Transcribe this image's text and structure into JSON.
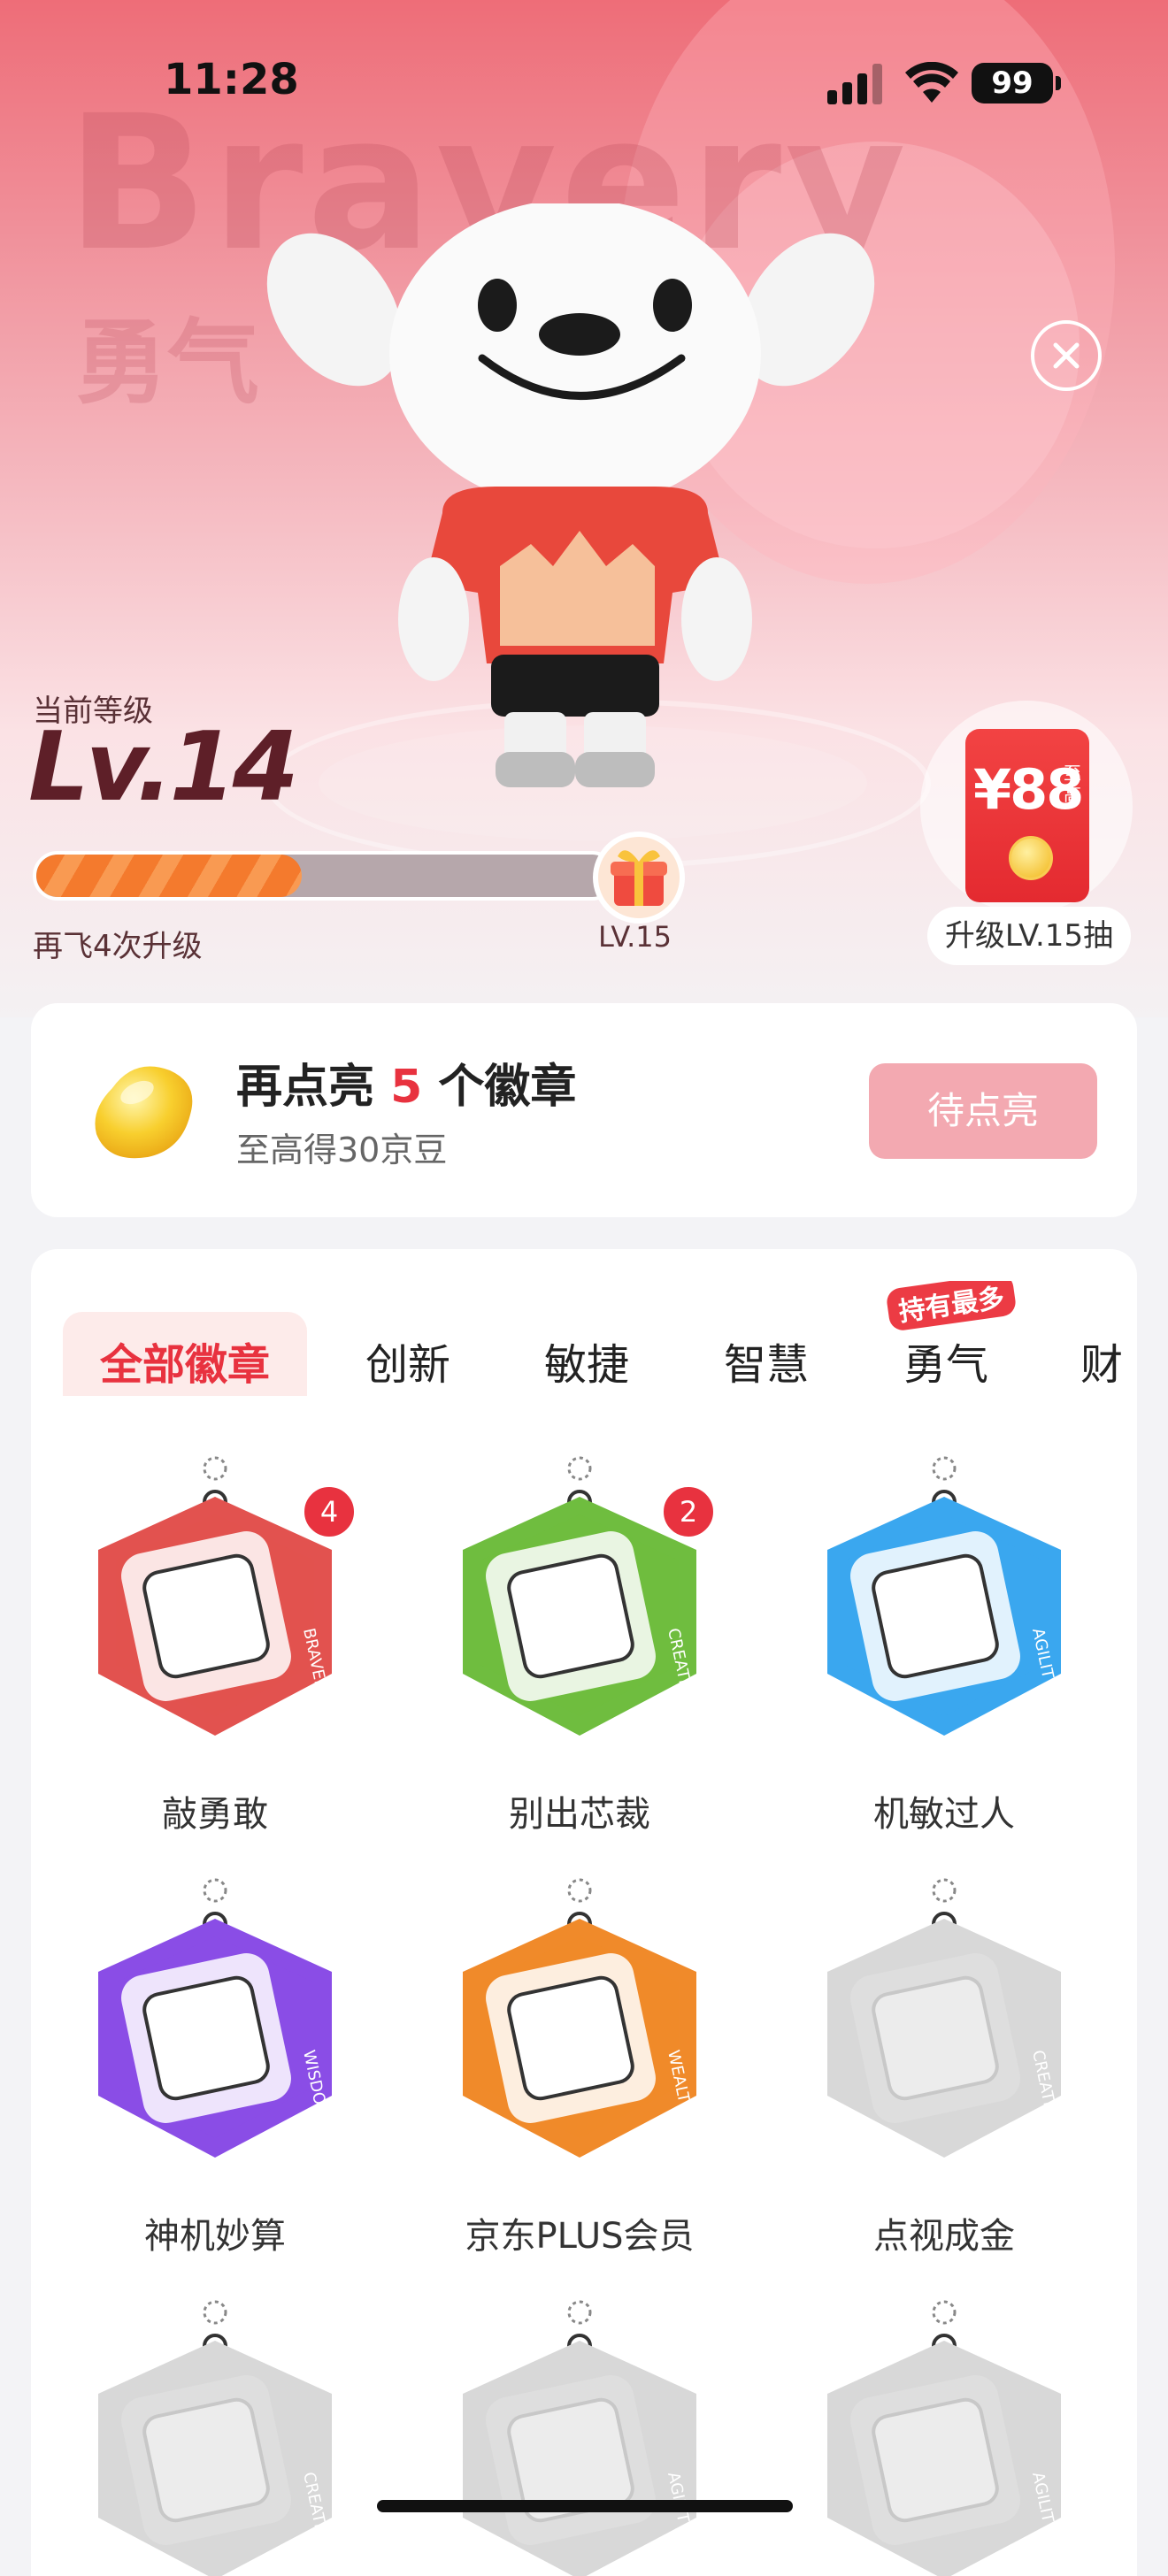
{
  "status_bar": {
    "time": "11:28",
    "battery": "99"
  },
  "hero": {
    "bg_word_en": "Bravery",
    "bg_word_cn": "勇气",
    "level_caption": "当前等级",
    "level_value": "Lv.14",
    "progress_fraction": 0.46,
    "remaining_text": "再飞4次升级",
    "next_level_label": "LV.15",
    "redpack": {
      "amount": "¥88",
      "suffix": "至高",
      "button": "升级LV.15抽"
    }
  },
  "bean_card": {
    "title_prefix": "再点亮",
    "title_count": "5",
    "title_suffix": "个徽章",
    "subtitle": "至高得30京豆",
    "button": "待点亮"
  },
  "tabs": {
    "items": [
      {
        "label": "全部徽章",
        "active": true
      },
      {
        "label": "创新"
      },
      {
        "label": "敏捷"
      },
      {
        "label": "智慧"
      },
      {
        "label": "勇气"
      },
      {
        "label": "财"
      }
    ],
    "hot_tag": "持有最多"
  },
  "badges": [
    {
      "name": "敲勇敢",
      "count": "4",
      "side_text": "BRAVERY",
      "color": "#e2524f",
      "icon": "keyboard-icon"
    },
    {
      "name": "别出芯裁",
      "count": "2",
      "side_text": "CREATION",
      "color": "#6fbd3f",
      "icon": "laptop-icon"
    },
    {
      "name": "机敏过人",
      "side_text": "AGILITY",
      "color": "#3aa7ef",
      "icon": "camera-icon"
    },
    {
      "name": "神机妙算",
      "side_text": "WISDOM",
      "color": "#8a4de6",
      "icon": "phone-icon"
    },
    {
      "name": "京东PLUS会员",
      "side_text": "WEALTH",
      "color": "#f08a2a",
      "icon": "crown-icon"
    },
    {
      "name": "点视成金",
      "side_text": "CREATION",
      "color": "#d8d8d8",
      "icon": "tv-icon"
    },
    {
      "side_text": "CREATION",
      "color": "#d8d8d8",
      "icon": "bear-icon"
    },
    {
      "side_text": "AGILITY",
      "color": "#d8d8d8",
      "icon": "air-conditioner-icon"
    },
    {
      "side_text": "AGILITY",
      "color": "#d8d8d8",
      "icon": "phone-icon"
    }
  ]
}
